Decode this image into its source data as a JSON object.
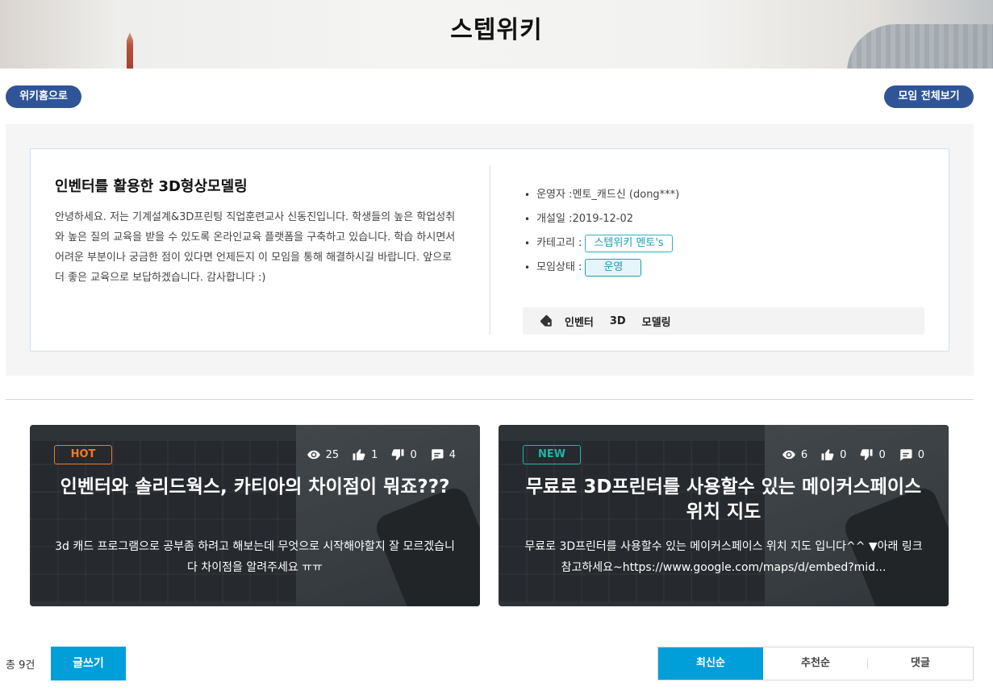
{
  "header": {
    "title": "스텝위키"
  },
  "nav": {
    "wiki_home": "위키홈으로",
    "all_groups": "모임 전체보기"
  },
  "group": {
    "name": "인벤터를 활용한 3D형상모델링",
    "description": "안녕하세요. 저는 기계설계&3D프린팅 직업훈련교사 신동진입니다. 학생들의 높은 학업성취와 높은 질의 교육을 받을 수 있도록 온라인교육 플랫폼을 구축하고 있습니다. 학습 하시면서 어려운 부분이나 궁금한 점이 있다면 언제든지 이 모임을 통해 해결하시길 바랍니다. 앞으로 더 좋은 교육으로 보답하겠습니다. 감사합니다 :)",
    "operator_label": "운영자 : ",
    "operator_value": "멘토_캐드신 (dong***)",
    "opened_label": "개설일 : ",
    "opened_value": "2019-12-02",
    "category_label": "카테고리 : ",
    "category_value": "스텝위키 멘토's",
    "status_label": "모임상태 : ",
    "status_value": "운영",
    "keywords": [
      "인벤터",
      "3D",
      "모델링"
    ]
  },
  "posts": [
    {
      "badge": "HOT",
      "views": "25",
      "likes": "1",
      "dislikes": "0",
      "comments": "4",
      "title": "인벤터와 솔리드웍스, 카티아의 차이점이 뭐죠???",
      "summary": "3d 캐드 프로그램으로 공부좀 하려고 해보는데 무엇으로 시작해야할지 잘 모르겠습니다 차이점을 알려주세요 ㅠㅠ"
    },
    {
      "badge": "NEW",
      "views": "6",
      "likes": "0",
      "dislikes": "0",
      "comments": "0",
      "title": "무료로 3D프린터를 사용할수 있는 메이커스페이스 위치 지도",
      "summary": "무료로 3D프린터를 사용할수 있는 메이커스페이스 위치 지도 입니다^^ ▼아래 링크 참고하세요~https://www.google.com/maps/d/embed?mid..."
    }
  ],
  "footer": {
    "total": "총 9건",
    "write": "글쓰기",
    "sort": [
      "최신순",
      "추천순",
      "댓글"
    ]
  },
  "colors": {
    "primary": "#009fd9",
    "navy": "#2f5597",
    "hot": "#f07a28",
    "new": "#22b3a8"
  }
}
